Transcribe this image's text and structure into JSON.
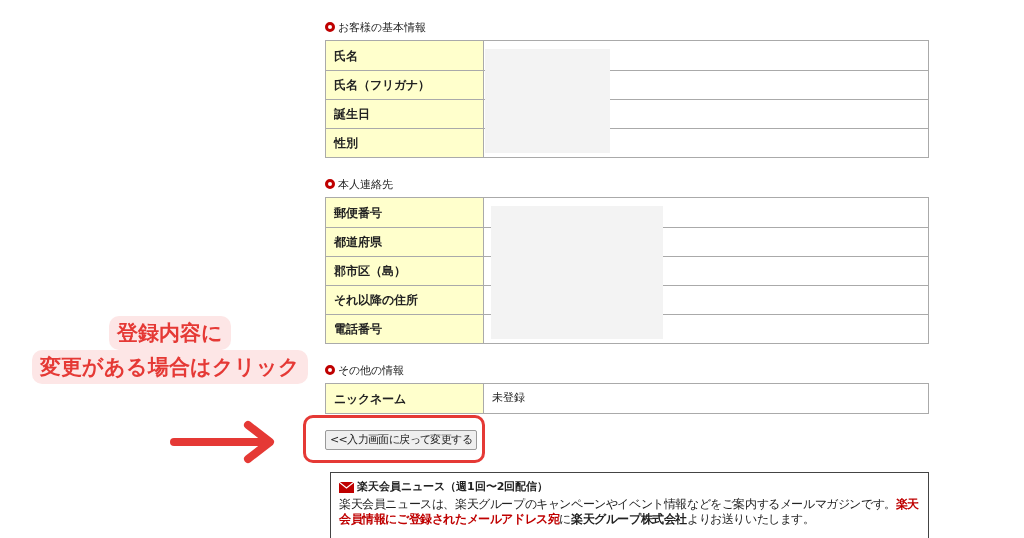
{
  "sections": [
    {
      "title": "お客様の基本情報",
      "redacted": true,
      "rows": [
        {
          "label": "氏名"
        },
        {
          "label": "氏名（フリガナ）"
        },
        {
          "label": "誕生日"
        },
        {
          "label": "性別"
        }
      ]
    },
    {
      "title": "本人連絡先",
      "redacted": true,
      "rows": [
        {
          "label": "郵便番号"
        },
        {
          "label": "都道府県"
        },
        {
          "label": "郡市区（島）"
        },
        {
          "label": "それ以降の住所"
        },
        {
          "label": "電話番号"
        }
      ]
    },
    {
      "title": "その他の情報",
      "redacted": false,
      "rows": [
        {
          "label": "ニックネーム",
          "value": "未登録"
        }
      ]
    }
  ],
  "back_button": {
    "label": "<<入力画面に戻って変更する"
  },
  "callout": {
    "lines": [
      "登録内容に",
      "変更がある場合はクリック"
    ]
  },
  "newsletter": {
    "title": "楽天会員ニュース（週1回〜2回配信）",
    "segments": [
      {
        "kind": "plain",
        "text": "楽天会員ニュースは、楽天グループのキャンペーンやイベント情報などをご案内するメールマガジンです。"
      },
      {
        "kind": "alert",
        "text": "楽天会員情報にご登録されたメールアドレス宛"
      },
      {
        "kind": "plain",
        "text": "に"
      },
      {
        "kind": "bold",
        "text": "楽天グループ株式会社"
      },
      {
        "kind": "plain",
        "text": "よりお送りいたします。"
      }
    ]
  }
}
